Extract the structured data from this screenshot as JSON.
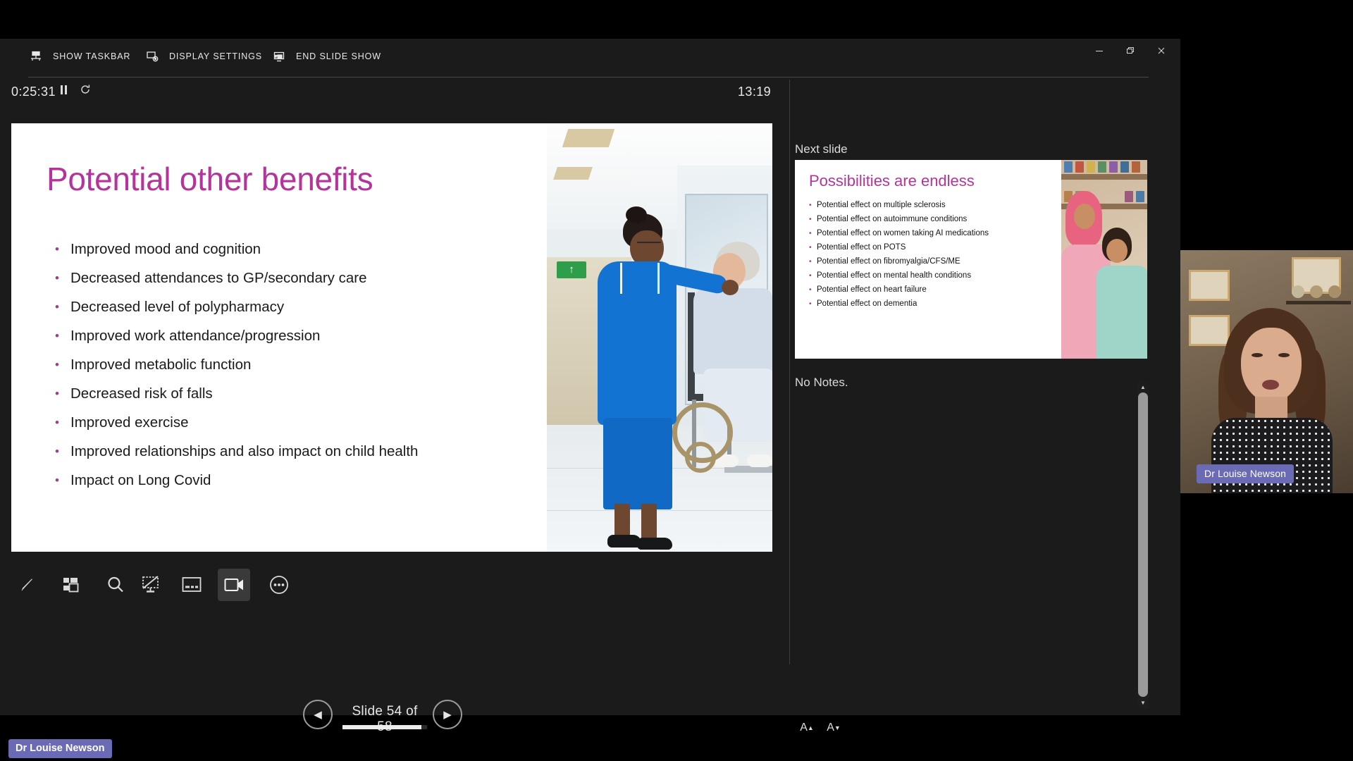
{
  "window": {
    "controls": {
      "minimize": "—",
      "restore": "❐",
      "close": "✕"
    }
  },
  "topbar": {
    "show_taskbar": "SHOW TASKBAR",
    "display_settings": "DISPLAY SETTINGS",
    "display_settings_caret": "▼",
    "end_slide_show": "END SLIDE SHOW"
  },
  "timer": {
    "elapsed": "0:25:31",
    "pause_icon": "❚❚",
    "reset_icon": "↺",
    "clock": "13:19"
  },
  "slide": {
    "title": "Potential other benefits",
    "title_color": "#b5349b",
    "bullet_char": "•",
    "bullets": [
      "Improved mood and cognition",
      "Decreased attendances to GP/secondary care",
      "Decreased level of polypharmacy",
      "Improved work attendance/progression",
      "Improved metabolic function",
      "Decreased risk of falls",
      "Improved exercise",
      "Improved relationships and also impact on child health",
      "Impact on Long Covid"
    ],
    "photo_alt": "nurse-with-patient-in-wheelchair-photo"
  },
  "toolbar": {
    "pen": "pen-tool",
    "grid": "see-all-slides",
    "zoom": "zoom-into-slide",
    "blank": "black-or-unblank-slide",
    "captions": "toggle-subtitles",
    "camera": "toggle-camera",
    "more": "more-slide-show-options"
  },
  "navigation": {
    "prev_icon": "◀",
    "next_icon": "▶",
    "counter": "Slide 54 of 58",
    "current": 54,
    "total": 58,
    "progress_percent": 93
  },
  "next_slide": {
    "label": "Next slide",
    "title": "Possibilities are endless",
    "bullet_char": "•",
    "bullets": [
      "Potential effect on multiple sclerosis",
      "Potential effect on autoimmune conditions",
      "Potential effect on women taking AI medications",
      "Potential effect on POTS",
      "Potential effect on fibromyalgia/CFS/ME",
      "Potential effect on mental health conditions",
      "Potential effect on heart failure",
      "Potential effect on dementia"
    ],
    "photo_alt": "mother-and-children-photo"
  },
  "notes": {
    "text": "No Notes.",
    "increase_font": "A",
    "decrease_font": "A",
    "increase_marker": "▲",
    "decrease_marker": "▼",
    "scroll_up": "▲",
    "scroll_down": "▼"
  },
  "webcam": {
    "name": "Dr Louise Newson",
    "badge_color": "#6a6ab5"
  },
  "taskbar": {
    "name": "Dr Louise Newson"
  }
}
